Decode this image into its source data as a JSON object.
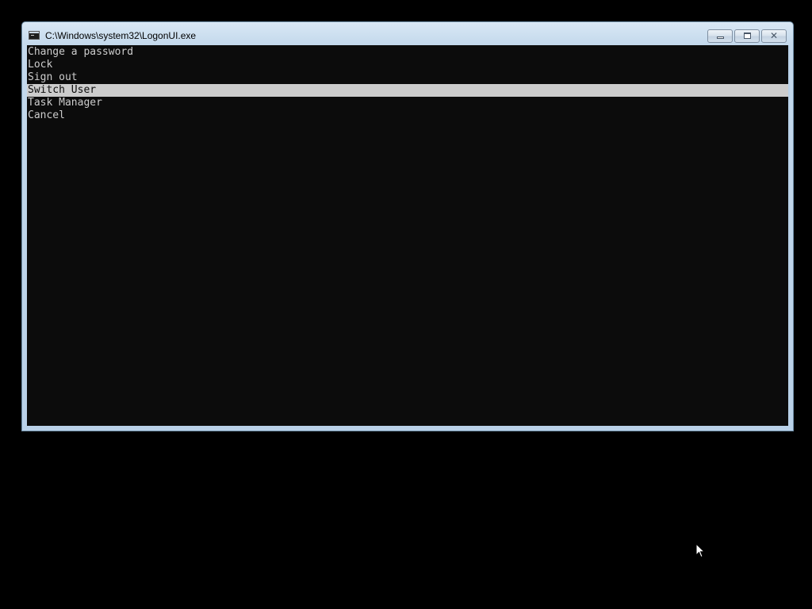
{
  "window": {
    "title": "C:\\Windows\\system32\\LogonUI.exe",
    "icon": "console-app-icon",
    "controls": {
      "minimize": "minimize",
      "maximize": "maximize",
      "close": "close"
    }
  },
  "console": {
    "background": "#0c0c0c",
    "text_color": "#cccccc",
    "highlight_background": "#cccccc",
    "menu": {
      "selected_label": "Switch User",
      "items": [
        {
          "label": "Change a password"
        },
        {
          "label": "Lock"
        },
        {
          "label": "Sign out"
        },
        {
          "label": "Switch User"
        },
        {
          "label": "Task Manager"
        },
        {
          "label": "Cancel"
        }
      ]
    }
  },
  "colors": {
    "desktop": "#000000",
    "window_frame": "#b9d1e8"
  }
}
